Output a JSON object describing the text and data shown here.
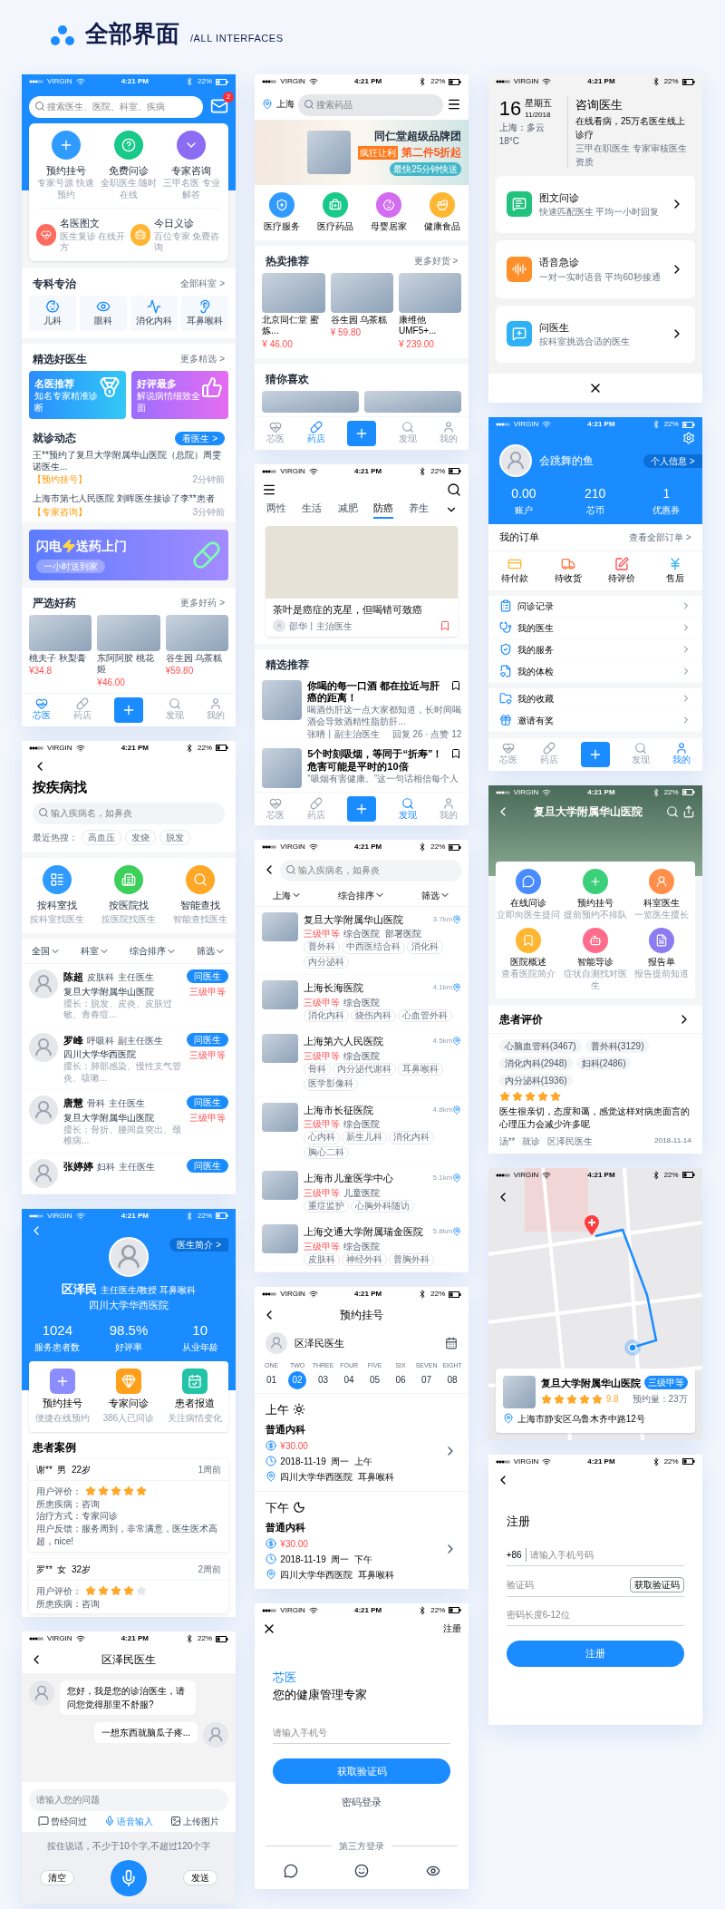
{
  "header": {
    "title": "全部界面",
    "subtitle": "/ALL INTERFACES"
  },
  "home": {
    "status": {
      "carrier": "VIRGIN",
      "time": "4:21 PM",
      "battery": "22%"
    },
    "search": {
      "placeholder": "搜索医生、医院、科室、疾病"
    },
    "badge": "2",
    "services": [
      {
        "title": "预约挂号",
        "subtitle": "专家号源 快速预约"
      },
      {
        "title": "免费问诊",
        "subtitle": "全职医生 随时在线"
      },
      {
        "title": "专家咨询",
        "subtitle": "三甲名医 专业解答"
      }
    ],
    "features": [
      {
        "title": "名医图文",
        "subtitle": "医生复诊 在线开方"
      },
      {
        "title": "今日义诊",
        "subtitle": "百位专家 免费咨询"
      }
    ],
    "specialty": {
      "title": "专科专治",
      "more": "全部科室 >",
      "items": [
        "儿科",
        "眼科",
        "消化内科",
        "耳鼻喉科"
      ]
    },
    "doctors": {
      "title": "精选好医生",
      "more": "更多精选 >",
      "cards": [
        {
          "title": "名医推荐",
          "subtitle": "知名专家精准诊断"
        },
        {
          "title": "好评最多",
          "subtitle": "解说病情细致全面"
        }
      ]
    },
    "visits": {
      "title": "就诊动态",
      "button": "看医生 >",
      "items": [
        {
          "text": "王**预约了复旦大学附属华山医院（总院）周雯诺医生...",
          "tag": "【预约挂号】",
          "time": "2分钟前"
        },
        {
          "text": "上海市第七人民医院 刘晖医生接诊了李**患者",
          "tag": "【专家咨询】",
          "time": "3分钟前"
        }
      ]
    },
    "banner": {
      "title_1": "闪电",
      "title_2": "送药上门",
      "button": "一小时送到家"
    },
    "drugs": {
      "title": "严选好药",
      "more": "更多好药 >",
      "items": [
        {
          "name": "桃夫子 秋梨膏",
          "price": "¥34.8"
        },
        {
          "name": "东阿阿胶 桃花姬",
          "price": "¥46.00"
        },
        {
          "name": "谷生园 乌茶糕",
          "price": "¥59.80"
        }
      ]
    },
    "tabbar": [
      {
        "kind": "tab",
        "label": "芯医",
        "selected": true
      },
      {
        "kind": "tab",
        "label": "药店",
        "selected": false
      },
      {
        "kind": "add"
      },
      {
        "kind": "tab",
        "label": "发现",
        "selected": false
      },
      {
        "kind": "tab",
        "label": "我的",
        "selected": false
      }
    ]
  },
  "disease_search": {
    "status": {
      "carrier": "VIRGIN",
      "time": "4:21 PM",
      "battery": "22%"
    },
    "title": "按疾病找",
    "search": {
      "placeholder": "输入疾病名，如鼻炎"
    },
    "hot_label": "最近热搜：",
    "hot_tags": [
      "高血压",
      "发烧",
      "脱发"
    ],
    "methods": [
      {
        "title": "按科室找",
        "subtitle": "按科室找医生"
      },
      {
        "title": "按医院找",
        "subtitle": "按医院找医生"
      },
      {
        "title": "智能查找",
        "subtitle": "智能查找医生"
      }
    ],
    "filters": [
      "全国",
      "科室",
      "综合排序",
      "筛选"
    ],
    "doctors": [
      {
        "name": "陈超",
        "dept": "皮肤科",
        "title": "主任医生",
        "hospital": "复旦大学附属华山医院",
        "skill": "擅长：脱发、皮炎、皮肤过敏、青春痘...",
        "button": "问医生",
        "level": "三级甲等"
      },
      {
        "name": "罗峰",
        "dept": "呼吸科",
        "title": "副主任医生",
        "hospital": "四川大学华西医院",
        "skill": "擅长：肺部感染、慢性支气管炎、咳嗽...",
        "button": "问医生",
        "level": "三级甲等"
      },
      {
        "name": "唐慧",
        "dept": "骨科",
        "title": "主任医生",
        "hospital": "复旦大学附属华山医院",
        "skill": "擅长：骨折、腰间盘突出、颈椎病...",
        "button": "问医生",
        "level": "三级甲等"
      },
      {
        "name": "张婷婷",
        "dept": "妇科",
        "title": "主任医生",
        "button": "问医生"
      }
    ]
  },
  "doctor": {
    "status": {
      "carrier": "VIRGIN",
      "time": "4:21 PM",
      "battery": "22%"
    },
    "intro": "医生简介 >",
    "name": "区泽民",
    "title": "主任医生/教授 耳鼻喉科",
    "hospital": "四川大学华西医院",
    "stats": [
      {
        "value": "1024",
        "label": "服务患者数"
      },
      {
        "value": "98.5%",
        "label": "好评率"
      },
      {
        "value": "10",
        "label": "从业年龄"
      }
    ],
    "actions": [
      {
        "title": "预约挂号",
        "subtitle": "便捷在线预约"
      },
      {
        "title": "专家问诊",
        "subtitle": "386人已问诊"
      },
      {
        "title": "患者报道",
        "subtitle": "关注病情变化"
      }
    ],
    "cases_title": "患者案例",
    "cases": [
      {
        "user": "谢**  男  22岁",
        "time": "1周前",
        "rating_label": "用户评价：",
        "stars": 5,
        "lines": [
          "所患疾病：咨询",
          "治疗方式：专家问诊",
          "用户反馈：服务周到，非常满意，医生医术高超，nice!"
        ]
      },
      {
        "user": "罗**  女  32岁",
        "time": "2周前",
        "rating_label": "用户评价：",
        "stars": 4,
        "lines": [
          "所患疾病：咨询"
        ]
      }
    ]
  },
  "chat": {
    "status": {
      "carrier": "VIRGIN",
      "time": "4:21 PM",
      "battery": "22%"
    },
    "title": "区泽民医生",
    "messages": [
      {
        "kind": "doctor",
        "text": "您好，我是您的诊治医生，请问您觉得那里不舒服?"
      },
      {
        "kind": "me",
        "text": "一想东西就脑瓜子疼..."
      }
    ],
    "input": {
      "placeholder": "请输入您的问题"
    },
    "tools": [
      {
        "label": "曾经问过",
        "selected": false
      },
      {
        "label": "语音输入",
        "selected": true
      },
      {
        "label": "上传图片",
        "selected": false
      }
    ],
    "hint": "按住说话，不少于10个字,不超过120个字",
    "clear": "清空",
    "send": "发送"
  },
  "pharmacy": {
    "status": {
      "carrier": "VIRGIN",
      "time": "4:21 PM",
      "battery": "22%"
    },
    "location": "上海",
    "search": {
      "placeholder": "搜索药品"
    },
    "banner": {
      "headline": "同仁堂超级品牌团",
      "tag": "疯狂让利",
      "promo": "第二件5折起",
      "badge": "最快25分钟快送"
    },
    "categories": [
      "医疗服务",
      "医疗药品",
      "母婴居家",
      "健康食品"
    ],
    "hot": {
      "title": "热卖推荐",
      "more": "更多好货 >",
      "items": [
        {
          "name": "北京同仁堂 蜜炼...",
          "price": "¥ 46.00"
        },
        {
          "name": "谷生园 乌茶糕",
          "price": "¥ 59.80"
        },
        {
          "name": "康维他UMF5+...",
          "price": "¥ 239.00"
        }
      ]
    },
    "guess": "猜你喜欢",
    "tabbar": [
      {
        "kind": "tab",
        "label": "芯医",
        "selected": false
      },
      {
        "kind": "tab",
        "label": "药店",
        "selected": true
      },
      {
        "kind": "add"
      },
      {
        "kind": "tab",
        "label": "发现",
        "selected": false
      },
      {
        "kind": "tab",
        "label": "我的",
        "selected": false
      }
    ]
  },
  "discover": {
    "status": {
      "carrier": "VIRGIN",
      "time": "4:21 PM",
      "battery": "22%"
    },
    "tabs": [
      {
        "label": "两性",
        "selected": false
      },
      {
        "label": "生活",
        "selected": false
      },
      {
        "label": "减肥",
        "selected": false
      },
      {
        "label": "防癌",
        "selected": true
      },
      {
        "label": "养生",
        "selected": false
      }
    ],
    "featured": {
      "title": "茶叶是癌症的克星，但喝错可致癌",
      "author": "邵华丨主治医生"
    },
    "section": "精选推荐",
    "articles": [
      {
        "title": "你喝的每一口酒 都在拉近与肝癌的距离！",
        "summary": "喝酒伤肝这一点大家都知道，长时间喝酒会导致酒精性脂肪肝...",
        "author": "张晴丨副主治医生",
        "stats": "回复 26 · 点赞 12"
      },
      {
        "title": "5个时刻吸烟，等同于“折寿”！危害可能是平时的10倍",
        "summary": "“吸烟有害健康。”这一句话相信每个人"
      }
    ],
    "tabbar": [
      {
        "kind": "tab",
        "label": "芯医",
        "selected": false
      },
      {
        "kind": "tab",
        "label": "药店",
        "selected": false
      },
      {
        "kind": "add"
      },
      {
        "kind": "tab",
        "label": "发现",
        "selected": true
      },
      {
        "kind": "tab",
        "label": "我的",
        "selected": false
      }
    ]
  },
  "hospital_list": {
    "status": {
      "carrier": "VIRGIN",
      "time": "4:21 PM",
      "battery": "22%"
    },
    "search": {
      "placeholder": "输入疾病名，如鼻炎"
    },
    "filters": [
      "上海",
      "综合排序",
      "筛选"
    ],
    "hospitals": [
      {
        "name": "复旦大学附属华山医院",
        "level": "三级甲等",
        "type": "综合医院  部署医院",
        "distance": "3.7km",
        "tags": [
          "普外科",
          "中西医结合科",
          "消化科",
          "内分泌科"
        ]
      },
      {
        "name": "上海长海医院",
        "level": "三级甲等",
        "type": "综合医院",
        "distance": "4.1km",
        "tags": [
          "消化内科",
          "烧伤内科",
          "心血管外科"
        ]
      },
      {
        "name": "上海第六人民医院",
        "level": "三级甲等",
        "type": "综合医院",
        "distance": "4.5km",
        "tags": [
          "骨科",
          "内分泌代谢科",
          "耳鼻喉科",
          "医学影像科"
        ]
      },
      {
        "name": "上海市长征医院",
        "level": "三级甲等",
        "type": "综合医院",
        "distance": "4.8km",
        "tags": [
          "心内科",
          "新生儿科",
          "消化内科",
          "胸心二科"
        ]
      },
      {
        "name": "上海市儿童医学中心",
        "level": "三级甲等",
        "type": "儿童医院",
        "distance": "5.1km",
        "tags": [
          "重症监护",
          "心胸外科随访"
        ]
      },
      {
        "name": "上海交通大学附属瑞金医院",
        "level": "三级甲等",
        "type": "综合医院",
        "distance": "5.8km",
        "tags": [
          "皮肤科",
          "神经外科",
          "普胸外科"
        ]
      }
    ]
  },
  "appointment": {
    "status": {
      "carrier": "VIRGIN",
      "time": "4:21 PM",
      "battery": "22%"
    },
    "title": "预约挂号",
    "doctor": "区泽民医生",
    "days": [
      {
        "label": "ONE",
        "number": "01",
        "selected": false
      },
      {
        "label": "TWO",
        "number": "02",
        "selected": true
      },
      {
        "label": "THREE",
        "number": "03",
        "selected": false
      },
      {
        "label": "FOUR",
        "number": "04",
        "selected": false
      },
      {
        "label": "FIVE",
        "number": "05",
        "selected": false
      },
      {
        "label": "SIX",
        "number": "06",
        "selected": false
      },
      {
        "label": "SEVEN",
        "number": "07",
        "selected": false
      },
      {
        "label": "EIGHT",
        "number": "08",
        "selected": false
      }
    ],
    "sessions": [
      {
        "kind": "morning",
        "period": "上午",
        "dept": "普通内科",
        "price": "¥30.00",
        "time": "2018-11-19  周一  上午",
        "place": "四川大学华西医院  耳鼻喉科"
      },
      {
        "kind": "afternoon",
        "period": "下午",
        "dept": "普通内科",
        "price": "¥30.00",
        "time": "2018-11-19  周一  下午",
        "place": "四川大学华西医院  耳鼻喉科"
      }
    ]
  },
  "login": {
    "status": {
      "carrier": "VIRGIN",
      "time": "4:21 PM",
      "battery": "22%"
    },
    "register": "注册",
    "brand": "芯医",
    "slogan": "您的健康管理专家",
    "phone": {
      "placeholder": "请输入手机号"
    },
    "button": "获取验证码",
    "alt": "密码登录",
    "third_party": "第三方登录"
  },
  "consult": {
    "status": {
      "carrier": "VIRGIN",
      "time": "4:21 PM",
      "battery": "22%"
    },
    "day": "16",
    "weekday": "星期五",
    "month": "11/2018",
    "weather": "上海：多云 18°C",
    "title": "咨询医生",
    "slogan": "在线看病，25万名医生线上诊疗",
    "subtitle": "三甲在职医生 专家审核医生资质",
    "options": [
      {
        "title": "图文问诊",
        "subtitle": "快速匹配医生 平均一小时回复"
      },
      {
        "title": "语音急诊",
        "subtitle": "一对一实时语音 平均60秒接通"
      },
      {
        "title": "问医生",
        "subtitle": "按科室挑选合适的医生"
      }
    ]
  },
  "profile": {
    "status": {
      "carrier": "VIRGIN",
      "time": "4:21 PM",
      "battery": "22%"
    },
    "name": "会跳舞的鱼",
    "info": "个人信息 >",
    "stats": [
      {
        "value": "0.00",
        "label": "账户"
      },
      {
        "value": "210",
        "label": "芯币"
      },
      {
        "value": "1",
        "label": "优惠券"
      }
    ],
    "orders": {
      "title": "我的订单",
      "more": "查看全部订单 >",
      "items": [
        "待付款",
        "待收货",
        "待评价",
        "售后"
      ]
    },
    "menu": [
      [
        "问诊记录",
        "我的医生",
        "我的服务",
        "我的体检"
      ],
      [
        "我的收藏",
        "邀请有奖"
      ]
    ],
    "tabbar": [
      {
        "kind": "tab",
        "label": "芯医",
        "selected": false
      },
      {
        "kind": "tab",
        "label": "药店",
        "selected": false
      },
      {
        "kind": "add"
      },
      {
        "kind": "tab",
        "label": "发现",
        "selected": false
      },
      {
        "kind": "tab",
        "label": "我的",
        "selected": true
      }
    ]
  },
  "hospital_detail": {
    "status": {
      "carrier": "VIRGIN",
      "time": "4:21 PM",
      "battery": "22%"
    },
    "title": "复旦大学附属华山医院",
    "services": [
      {
        "title": "在线问诊",
        "subtitle": "立即向医生提问"
      },
      {
        "title": "预约挂号",
        "subtitle": "提前预约不排队"
      },
      {
        "title": "科室医生",
        "subtitle": "一览医生擅长"
      },
      {
        "title": "医院概述",
        "subtitle": "查看医院简介"
      },
      {
        "title": "智能导诊",
        "subtitle": "症状自测找对医生"
      },
      {
        "title": "报告单",
        "subtitle": "报告提前知道"
      }
    ],
    "reviews": {
      "title": "患者评价",
      "tags": [
        "心脑血管科(3467)",
        "普外科(3129)",
        "消化内科(2948)",
        "妇科(2486)",
        "内分泌科(1936)"
      ],
      "stars": 5,
      "text": "医生很亲切，态度和蔼，感觉这样对病患面言的心理压力会减少许多呢",
      "user": "汤**",
      "type": "就诊",
      "doctor": "区泽民医生",
      "date": "2018-11-14"
    }
  },
  "map": {
    "status": {
      "carrier": "VIRGIN",
      "time": "4:21 PM",
      "battery": "22%"
    },
    "card": {
      "name": "复旦大学附属华山医院",
      "level": "三级甲等",
      "stars": 5,
      "score": "9.8",
      "count": "预约量：23万",
      "address": "上海市静安区乌鲁木齐中路12号"
    }
  },
  "register": {
    "status": {
      "carrier": "VIRGIN",
      "time": "4:21 PM",
      "battery": "22%"
    },
    "title": "注册",
    "code": "+86",
    "phone": {
      "placeholder": "请输入手机号码"
    },
    "verify": {
      "placeholder": "验证码"
    },
    "get_code": "获取验证码",
    "password": {
      "placeholder": "密码长度6-12位"
    },
    "button": "注册"
  }
}
